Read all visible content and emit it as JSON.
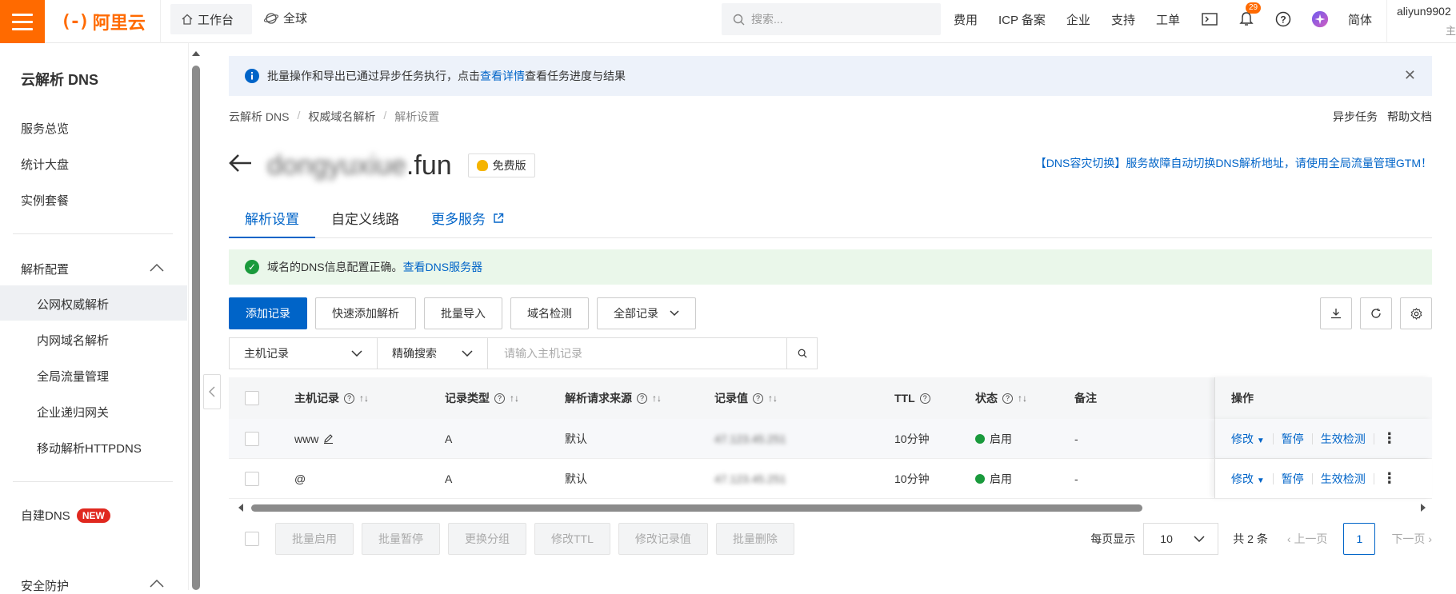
{
  "topbar": {
    "logo_mark": "(-)",
    "logo_text": "阿里云",
    "workbench": "工作台",
    "global": "全球",
    "search_placeholder": "搜索...",
    "links": [
      "费用",
      "ICP 备案",
      "企业",
      "支持",
      "工单"
    ],
    "notification_count": "29",
    "language": "简体",
    "user_name": "aliyun9902",
    "user_role": "主"
  },
  "sidebar": {
    "title": "云解析 DNS",
    "items_top": [
      "服务总览",
      "统计大盘",
      "实例套餐"
    ],
    "group_dns": "解析配置",
    "dns_sub": [
      "公网权威解析",
      "内网域名解析",
      "全局流量管理",
      "企业递归网关",
      "移动解析HTTPDNS"
    ],
    "self_dns": "自建DNS",
    "new_badge": "NEW",
    "group_security": "安全防护"
  },
  "notice": {
    "text_before": "批量操作和导出已通过异步任务执行，点击",
    "link": "查看详情",
    "text_after": "查看任务进度与结果"
  },
  "breadcrumb": [
    "云解析 DNS",
    "权威域名解析",
    "解析设置"
  ],
  "header_links": [
    "异步任务",
    "帮助文档"
  ],
  "domain": {
    "blurred_part": "dongyuxiue",
    "suffix": ".fun",
    "plan": "免费版",
    "gtm_link": "【DNS容灾切换】服务故障自动切换DNS解析地址，请使用全局流量管理GTM！"
  },
  "tabs": [
    "解析设置",
    "自定义线路",
    "更多服务"
  ],
  "dns_status": {
    "text": "域名的DNS信息配置正确。",
    "link": "查看DNS服务器"
  },
  "toolbar": {
    "add": "添加记录",
    "quick_add": "快速添加解析",
    "import": "批量导入",
    "check": "域名检测",
    "all_records": "全部记录"
  },
  "filter": {
    "field": "主机记录",
    "mode": "精确搜索",
    "placeholder": "请输入主机记录"
  },
  "table": {
    "headers": [
      "主机记录",
      "记录类型",
      "解析请求来源",
      "记录值",
      "TTL",
      "状态",
      "备注",
      "操作"
    ],
    "rows": [
      {
        "host": "www",
        "type": "A",
        "source": "默认",
        "value": "47.123.45.251",
        "ttl": "10分钟",
        "status": "启用",
        "remark": "-"
      },
      {
        "host": "@",
        "type": "A",
        "source": "默认",
        "value": "47.123.45.251",
        "ttl": "10分钟",
        "status": "启用",
        "remark": "-"
      }
    ],
    "op_modify": "修改",
    "op_pause": "暂停",
    "op_check": "生效检测"
  },
  "bulk": [
    "批量启用",
    "批量暂停",
    "更换分组",
    "修改TTL",
    "修改记录值",
    "批量删除"
  ],
  "pager": {
    "per_page_label": "每页显示",
    "per_page": "10",
    "total": "共 2 条",
    "prev": "上一页",
    "current": "1",
    "next": "下一页"
  }
}
